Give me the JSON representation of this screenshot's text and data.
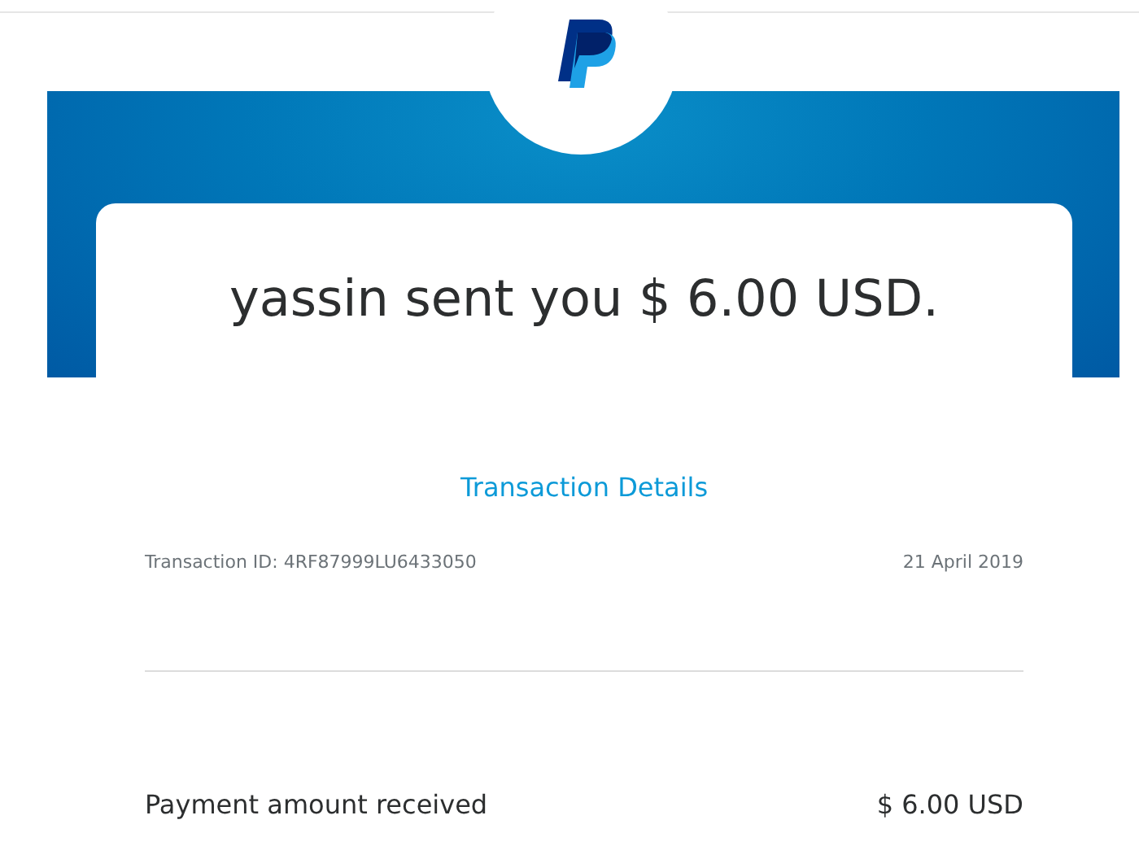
{
  "headline": "yassin sent you $ 6.00 USD.",
  "details_link": "Transaction Details",
  "transaction_id": "Transaction ID: 4RF87999LU6433050",
  "date": "21 April 2019",
  "payment": {
    "label": "Payment amount received",
    "amount": "$ 6.00 USD"
  }
}
